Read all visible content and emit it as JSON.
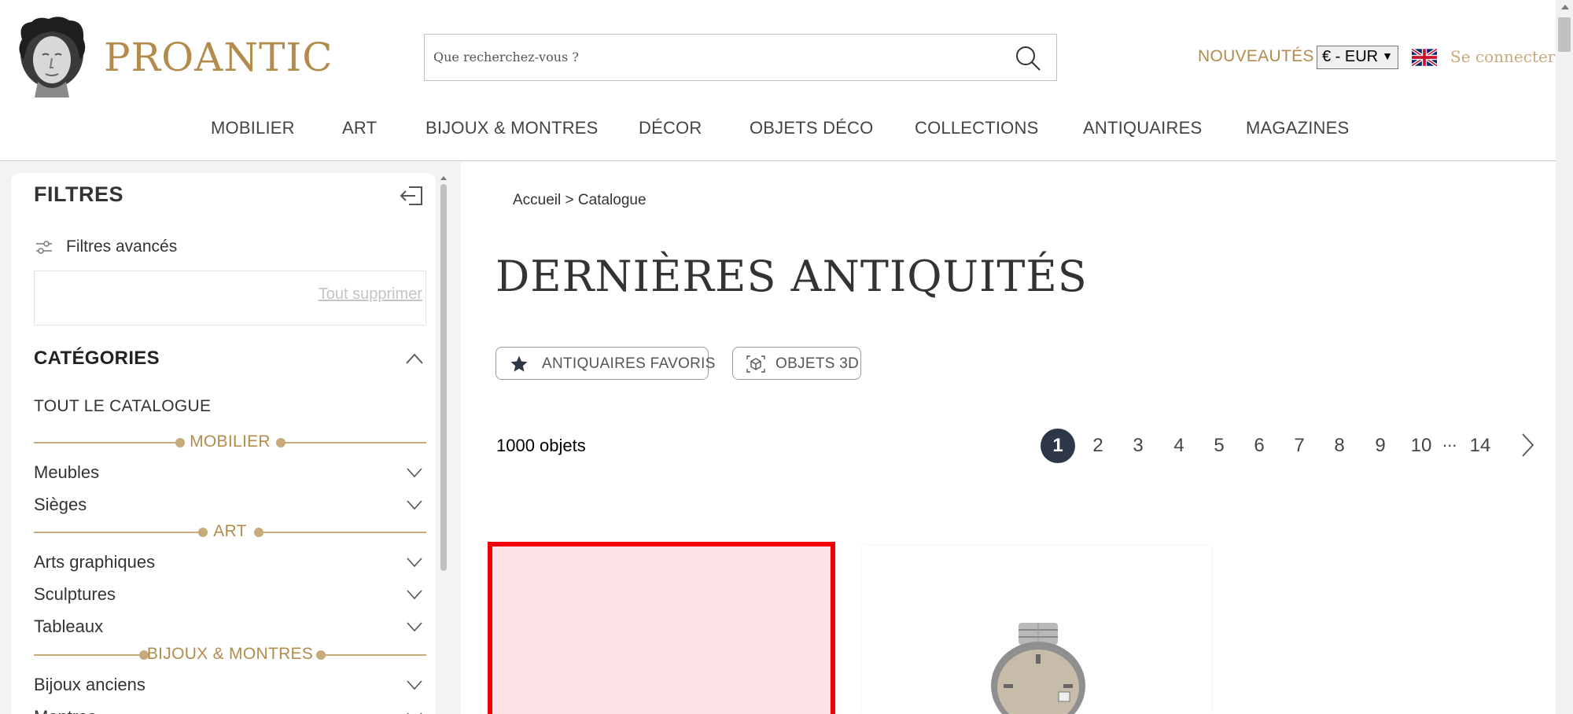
{
  "header": {
    "logo_text": "PROANTIC",
    "search_placeholder": "Que recherchez-vous ?",
    "new_label": "NOUVEAUTÉS",
    "currency": "€ - EUR",
    "login_label": "Se connecter",
    "language_flag": "uk-flag-icon"
  },
  "nav": {
    "items": [
      "MOBILIER",
      "ART",
      "BIJOUX & MONTRES",
      "DÉCOR",
      "OBJETS DÉCO",
      "COLLECTIONS",
      "ANTIQUAIRES",
      "MAGAZINES"
    ]
  },
  "sidebar": {
    "title": "FILTRES",
    "advanced_filters": "Filtres avancés",
    "clear_all": "Tout supprimer",
    "categories_title": "CATÉGORIES",
    "all_catalogue": "TOUT LE CATALOGUE",
    "sections": [
      {
        "label": "MOBILIER",
        "items": [
          "Meubles",
          "Sièges"
        ]
      },
      {
        "label": "ART",
        "items": [
          "Arts graphiques",
          "Sculptures",
          "Tableaux"
        ]
      },
      {
        "label": "BIJOUX & MONTRES",
        "items": [
          "Bijoux anciens",
          "Montres"
        ]
      }
    ]
  },
  "main": {
    "breadcrumb": "Accueil > Catalogue",
    "title": "DERNIÈRES ANTIQUITÉS",
    "filter_pills": [
      "ANTIQUAIRES FAVORIS",
      "OBJETS 3D"
    ],
    "count_label": "1000 objets",
    "pagination": {
      "pages": [
        "1",
        "2",
        "3",
        "4",
        "5",
        "6",
        "7",
        "8",
        "9",
        "10"
      ],
      "current": "1",
      "ellipsis": "...",
      "last": "14"
    }
  },
  "colors": {
    "brand_gold": "#b38c4d",
    "dark_navy": "#2e3748",
    "highlight_red": "#f00000"
  }
}
